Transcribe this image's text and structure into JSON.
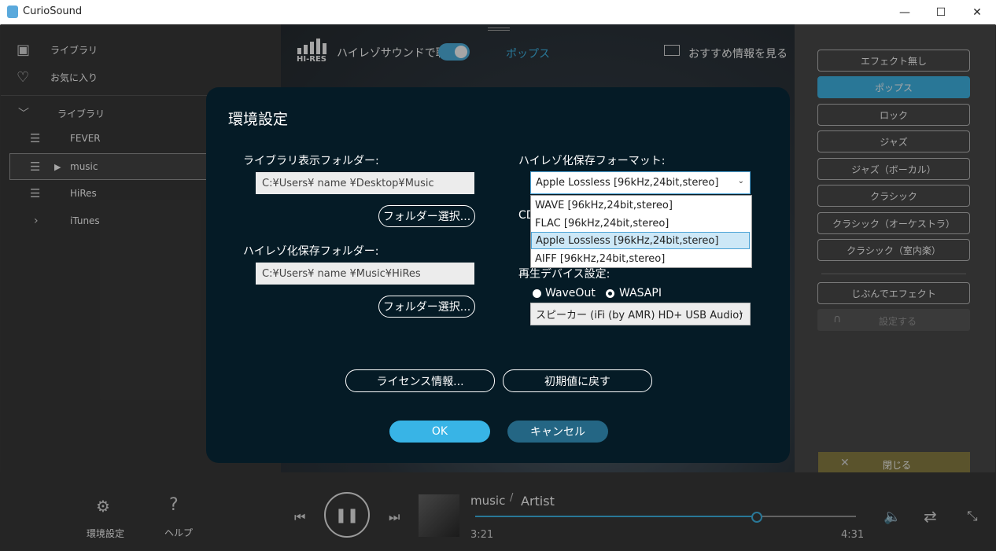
{
  "window": {
    "title": "CurioSound",
    "minimize": "—",
    "maximize": "☐",
    "close": "✕"
  },
  "sidebar": {
    "top_items": [
      {
        "label": "ライブラリ"
      },
      {
        "label": "お気に入り"
      }
    ],
    "library_header": "ライブラリ",
    "playlists": [
      {
        "label": "FEVER"
      },
      {
        "label": "music"
      },
      {
        "label": "HiRes"
      },
      {
        "label": "iTunes"
      }
    ],
    "settings_label": "環境設定",
    "help_label": "ヘルプ"
  },
  "header": {
    "hires_badge": "HI-RES",
    "hires_listen": "ハイレゾサウンドで聴く",
    "current_preset": "ポップス",
    "recommend": "おすすめ情報を見る"
  },
  "presets": {
    "items": [
      "エフェクト無し",
      "ポップス",
      "ロック",
      "ジャズ",
      "ジャズ（ボーカル）",
      "クラシック",
      "クラシック（オーケストラ）",
      "クラシック（室内楽）"
    ],
    "active": "ポップス",
    "custom": "じぶんでエフェクト",
    "setup": "設定する",
    "close": "閉じる"
  },
  "dialog": {
    "title": "環境設定",
    "library_folder_label": "ライブラリ表示フォルダー:",
    "library_folder_value": "C:¥Users¥ name  ¥Desktop¥Music",
    "browse1": "フォルダー選択...",
    "hires_folder_label": "ハイレゾ化保存フォルダー:",
    "hires_folder_value": "C:¥Users¥ name  ¥Music¥HiRes",
    "browse2": "フォルダー選択...",
    "format_label": "ハイレゾ化保存フォーマット:",
    "format_selected": "Apple Lossless [96kHz,24bit,stereo]",
    "format_options": [
      "WAVE [96kHz,24bit,stereo]",
      "FLAC [96kHz,24bit,stereo]",
      "Apple Lossless [96kHz,24bit,stereo]",
      "AIFF [96kHz,24bit,stereo]"
    ],
    "hidden_label_fragment": "CD",
    "device_label": "再生デバイス設定:",
    "waveout": "WaveOut",
    "wasapi": "WASAPI",
    "device_value": "スピーカー (iFi (by AMR) HD+ USB Audio)",
    "license": "ライセンス情報...",
    "reset": "初期値に戻す",
    "ok": "OK",
    "cancel": "キャンセル"
  },
  "player": {
    "album": "music",
    "separator": "/",
    "artist": "Artist",
    "elapsed": "3:21",
    "total": "4:31",
    "progress": 0.74
  }
}
